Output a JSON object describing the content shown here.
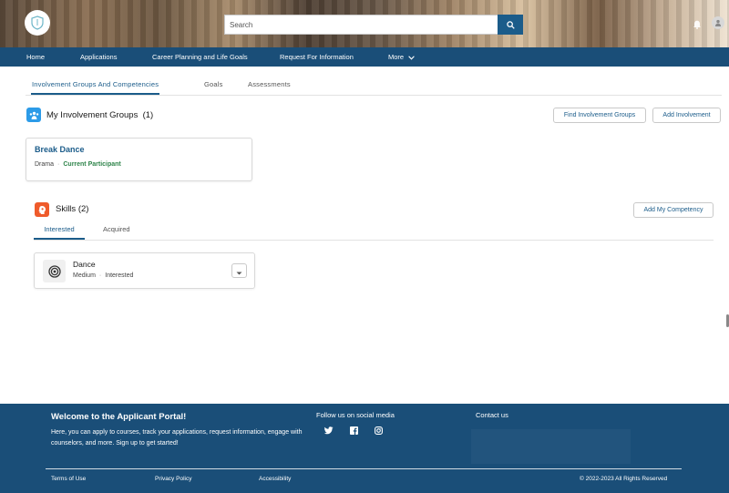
{
  "colors": {
    "brand_navy": "#1a4e78",
    "accent_blue": "#1b5c8a",
    "status_green": "#2e844a",
    "groups_icon_bg": "#2c9be8",
    "skills_icon_bg": "#ef5b2b"
  },
  "header": {
    "logo_icon": "shield-icon",
    "search": {
      "placeholder": "Search",
      "icon": "search-icon"
    },
    "notification_icon": "bell-icon",
    "avatar_icon": "user-icon"
  },
  "nav": {
    "items": [
      "Home",
      "Applications",
      "Career Planning and Life Goals",
      "Request For Information",
      "More"
    ]
  },
  "tabs": {
    "items": [
      "Involvement Groups And Competencies",
      "Goals",
      "Assessments"
    ],
    "active": "Involvement Groups And Competencies"
  },
  "involvement": {
    "title": "My Involvement Groups",
    "count": "(1)",
    "icon": "groups-icon",
    "find_button": "Find Involvement Groups",
    "add_button": "Add Involvement",
    "card": {
      "name": "Break Dance",
      "category": "Drama",
      "status": "Current Participant"
    }
  },
  "skills": {
    "title": "Skills",
    "count": "(2)",
    "icon": "skills-icon",
    "add_button": "Add My Competency",
    "subtabs": [
      "Interested",
      "Acquired"
    ],
    "active": "Interested",
    "card": {
      "name": "Dance",
      "level": "Medium",
      "status": "Interested",
      "icon": "target-icon"
    }
  },
  "footer": {
    "title": "Welcome to the Applicant Portal!",
    "description": "Here, you can apply to courses, track your applications, request information, engage with counselors, and more. Sign up to get started!",
    "follow_label": "Follow us on social media",
    "social_icons": [
      "twitter-icon",
      "facebook-icon",
      "instagram-icon"
    ],
    "contact_label": "Contact us",
    "links": [
      "Terms of Use",
      "Privacy Policy",
      "Accessibility"
    ],
    "copyright": "© 2022-2023 All Rights Reserved"
  }
}
